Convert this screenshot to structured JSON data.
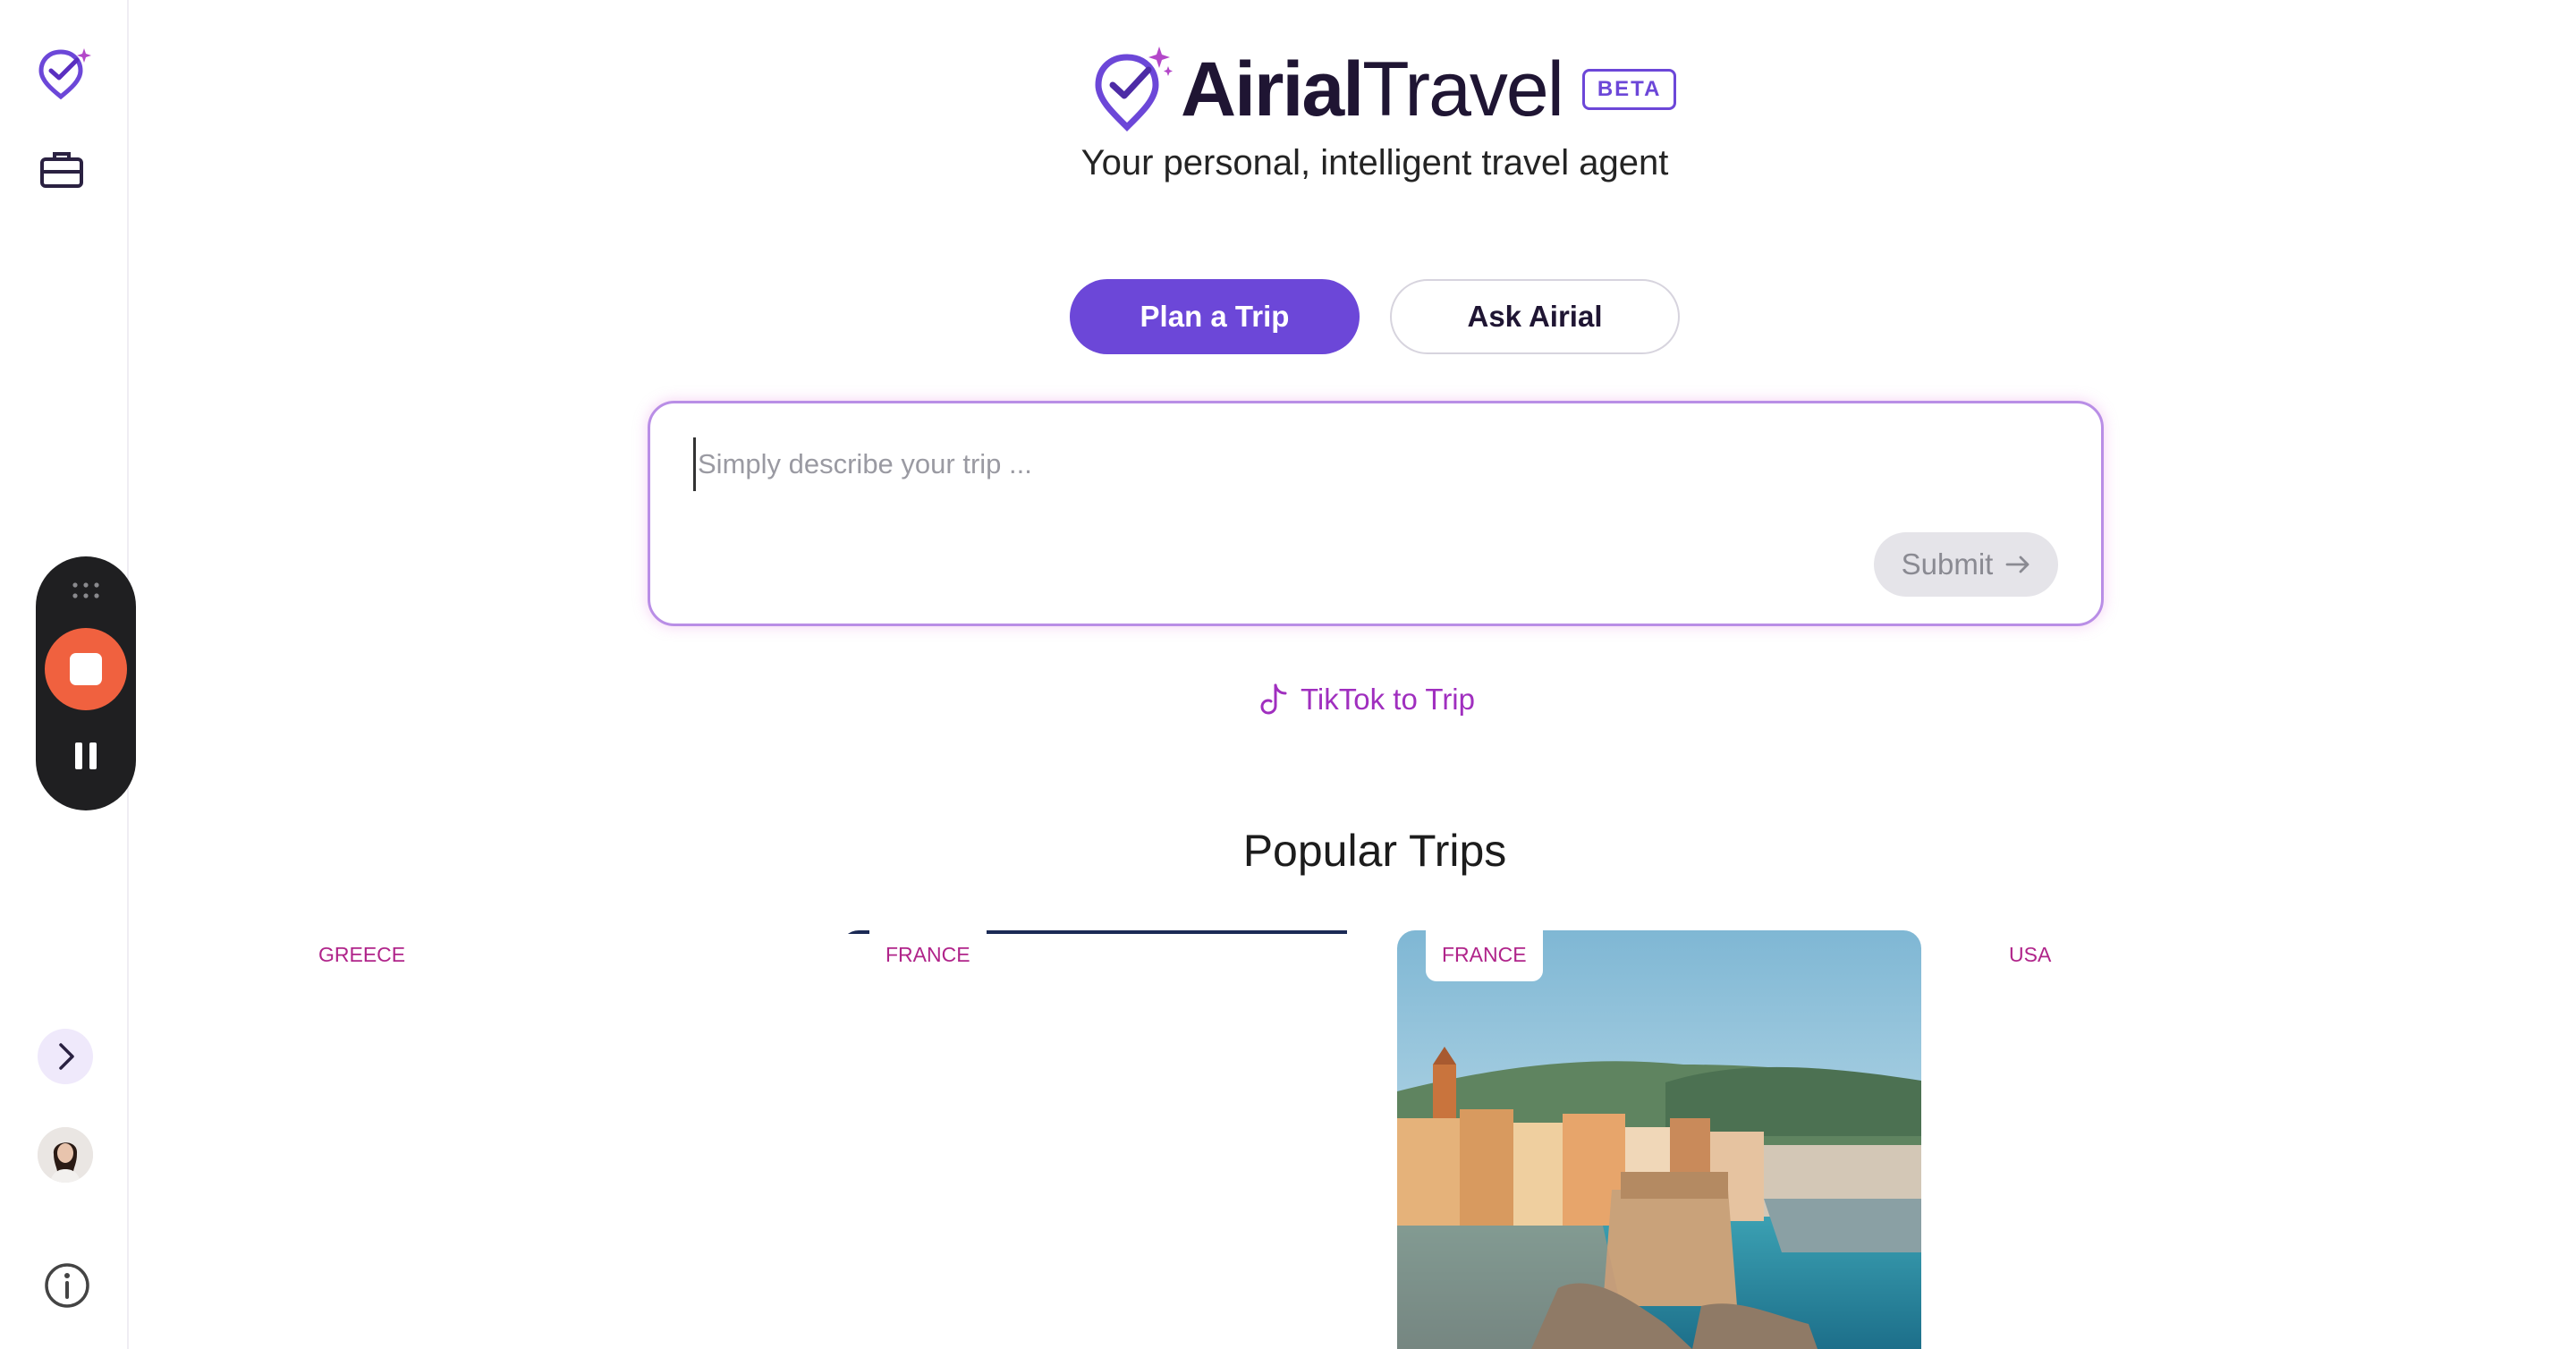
{
  "brand": {
    "name_bold": "Airial",
    "name_light": "Travel",
    "badge": "BETA",
    "tagline": "Your personal, intelligent travel agent"
  },
  "tabs": {
    "plan": "Plan a Trip",
    "ask": "Ask Airial"
  },
  "prompt": {
    "placeholder": "Simply describe your trip ...",
    "value": "",
    "submit": "Submit"
  },
  "tiktok": {
    "label": "TikTok to Trip"
  },
  "popular": {
    "title": "Popular Trips",
    "trips": [
      {
        "country": "GREECE"
      },
      {
        "country": "FRANCE"
      },
      {
        "country": "FRANCE"
      },
      {
        "country": "USA"
      }
    ]
  },
  "colors": {
    "accent": "#6c47d8",
    "tag": "#b0248a",
    "recorder_stop": "#f0613f"
  },
  "icons": {
    "sidebar_logo": "map-pin-check-icon",
    "sidebar_trips": "briefcase-icon",
    "recorder_grip": "drag-handle-icon",
    "recorder_stop": "stop-icon",
    "recorder_pause": "pause-icon",
    "expand": "chevron-right-icon",
    "info": "info-icon",
    "submit": "arrow-right-icon",
    "tiktok": "tiktok-icon"
  }
}
